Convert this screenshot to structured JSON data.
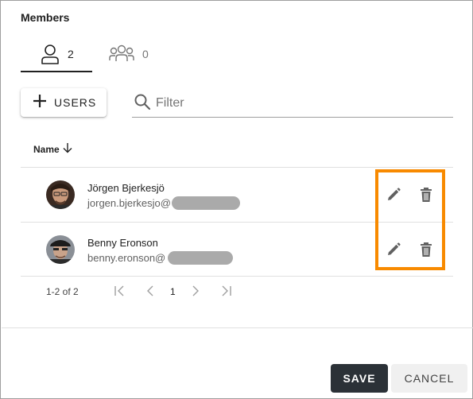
{
  "dialog": {
    "title": "Members"
  },
  "tabs": [
    {
      "icon": "user-icon",
      "count": "2"
    },
    {
      "icon": "users-group-icon",
      "count": "0"
    }
  ],
  "toolbar": {
    "add_label": "USERS",
    "filter_placeholder": "Filter"
  },
  "table": {
    "columns": [
      {
        "label": "Name",
        "sort": "descending"
      }
    ],
    "rows": [
      {
        "name": "Jörgen Bjerkesjö",
        "email": "jorgen.bjerkesjo@"
      },
      {
        "name": "Benny Eronson",
        "email": "benny.eronson@"
      }
    ]
  },
  "pagination": {
    "range": "1-2 of 2",
    "page": "1"
  },
  "footer": {
    "save_label": "SAVE",
    "cancel_label": "CANCEL"
  },
  "colors": {
    "accent_highlight": "#f88a00",
    "primary_button": "#2b3137",
    "tab_indicator": "#212121"
  }
}
